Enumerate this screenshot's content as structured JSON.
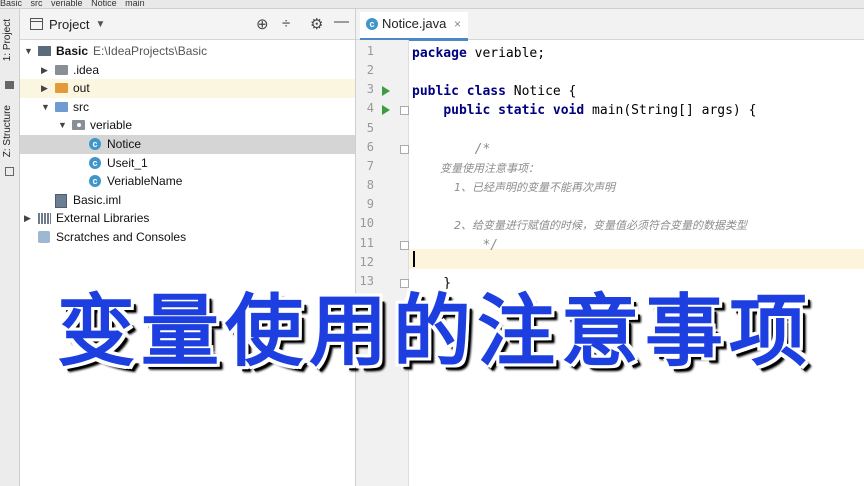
{
  "breadcrumb": [
    "Basic",
    "src",
    "veriable",
    "Notice",
    "main"
  ],
  "toolwindows": {
    "project": "1: Project",
    "structure": "Z: Structure"
  },
  "project_panel": {
    "title": "Project",
    "tree": [
      {
        "label": "Basic",
        "path": "E:\\IdeaProjects\\Basic",
        "kind": "module",
        "depth": 0,
        "expanded": true
      },
      {
        "label": ".idea",
        "kind": "folder",
        "depth": 1,
        "expanded": false
      },
      {
        "label": "out",
        "kind": "folder-orange",
        "depth": 1,
        "expanded": false
      },
      {
        "label": "src",
        "kind": "folder-blue",
        "depth": 1,
        "expanded": true
      },
      {
        "label": "veriable",
        "kind": "package",
        "depth": 2,
        "expanded": true
      },
      {
        "label": "Notice",
        "kind": "class",
        "depth": 3,
        "selected": true
      },
      {
        "label": "Useit_1",
        "kind": "class",
        "depth": 3
      },
      {
        "label": "VeriableName",
        "kind": "class",
        "depth": 3
      },
      {
        "label": "Basic.iml",
        "kind": "iml",
        "depth": 1
      },
      {
        "label": "External Libraries",
        "kind": "libs",
        "depth": 0,
        "expanded": false
      },
      {
        "label": "Scratches and Consoles",
        "kind": "scratch",
        "depth": 0
      }
    ]
  },
  "editor": {
    "tab": "Notice.java",
    "lines": [
      {
        "n": "1",
        "code": "package veriable;"
      },
      {
        "n": "2",
        "code": ""
      },
      {
        "n": "3",
        "code": "public class Notice {",
        "run": true
      },
      {
        "n": "4",
        "code": "    public static void main(String[] args) {",
        "run": true
      },
      {
        "n": "5",
        "code": ""
      },
      {
        "n": "6",
        "code": "        /*"
      },
      {
        "n": "7",
        "code": "        变量使用注意事项："
      },
      {
        "n": "8",
        "code": "            1、已经声明的变量不能再次声明"
      },
      {
        "n": "9",
        "code": ""
      },
      {
        "n": "10",
        "code": "            2、给变量进行赋值的时候，变量值必须符合变量的数据类型"
      },
      {
        "n": "11",
        "code": "         */"
      },
      {
        "n": "12",
        "code": ""
      },
      {
        "n": "13",
        "code": "    }"
      },
      {
        "n": "14",
        "code": ""
      }
    ]
  },
  "overlay": "变量使用的注意事项"
}
